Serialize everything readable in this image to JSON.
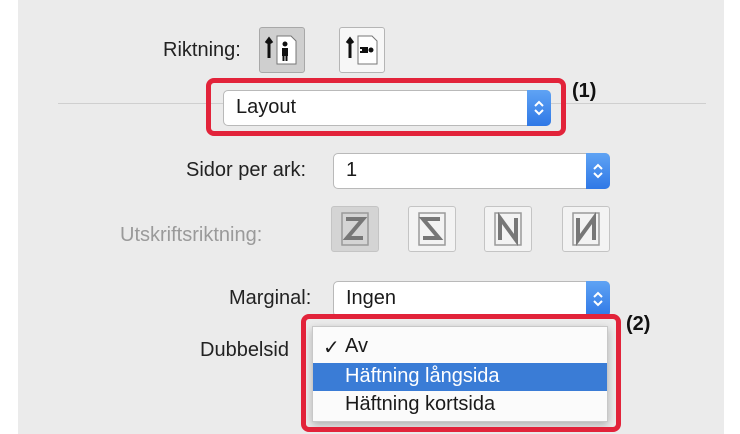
{
  "orientation": {
    "label": "Riktning:",
    "options": [
      "portrait-person-icon",
      "landscape-person-icon"
    ],
    "selected": 0
  },
  "panel_select": {
    "value": "Layout"
  },
  "pages_per_sheet": {
    "label": "Sidor per ark:",
    "value": "1"
  },
  "layout_direction": {
    "label": "Utskriftsriktning:",
    "options": [
      "z-order-icon",
      "reverse-z-order-icon",
      "n-order-icon",
      "reverse-n-order-icon"
    ]
  },
  "border": {
    "label": "Marginal:",
    "value": "Ingen"
  },
  "two_sided": {
    "label": "Dubbelsid",
    "menu": [
      {
        "label": "Av",
        "checked": true
      },
      {
        "label": "Häftning långsida",
        "highlighted": true
      },
      {
        "label": "Häftning kortsida"
      }
    ]
  },
  "callouts": [
    "(1)",
    "(2)"
  ],
  "colors": {
    "callout_red": "#e2233a",
    "accent_blue": "#3a7cd6",
    "panel_gray": "#ebebeb"
  }
}
